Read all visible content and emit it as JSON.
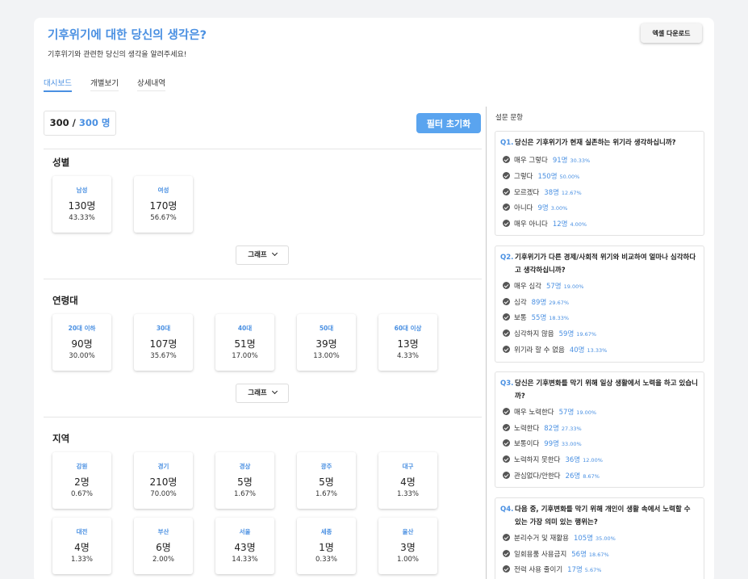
{
  "header": {
    "title": "기후위기에 대한 당신의 생각은?",
    "subtitle": "기후위기와 관련한 당신의 생각을 알려주세요!",
    "excel_label": "엑셀 다운로드"
  },
  "tabs": [
    {
      "label": "대시보드",
      "active": true
    },
    {
      "label": "개별보기",
      "active": false
    },
    {
      "label": "상세내역",
      "active": false
    }
  ],
  "counter": {
    "current": "300",
    "sep": " / ",
    "total": "300 명"
  },
  "reset_label": "필터 초기화",
  "graph_label": "그래프",
  "sections": [
    {
      "title": "성별",
      "cards": [
        {
          "label": "남성",
          "count": "130명",
          "pct": "43.33%"
        },
        {
          "label": "여성",
          "count": "170명",
          "pct": "56.67%"
        }
      ]
    },
    {
      "title": "연령대",
      "cards": [
        {
          "label": "20대 이하",
          "count": "90명",
          "pct": "30.00%"
        },
        {
          "label": "30대",
          "count": "107명",
          "pct": "35.67%"
        },
        {
          "label": "40대",
          "count": "51명",
          "pct": "17.00%"
        },
        {
          "label": "50대",
          "count": "39명",
          "pct": "13.00%"
        },
        {
          "label": "60대 이상",
          "count": "13명",
          "pct": "4.33%"
        }
      ]
    },
    {
      "title": "지역",
      "cards": [
        {
          "label": "강원",
          "count": "2명",
          "pct": "0.67%"
        },
        {
          "label": "경기",
          "count": "210명",
          "pct": "70.00%"
        },
        {
          "label": "경상",
          "count": "5명",
          "pct": "1.67%"
        },
        {
          "label": "광주",
          "count": "5명",
          "pct": "1.67%"
        },
        {
          "label": "대구",
          "count": "4명",
          "pct": "1.33%"
        },
        {
          "label": "대전",
          "count": "4명",
          "pct": "1.33%"
        },
        {
          "label": "부산",
          "count": "6명",
          "pct": "2.00%"
        },
        {
          "label": "서울",
          "count": "43명",
          "pct": "14.33%"
        },
        {
          "label": "세종",
          "count": "1명",
          "pct": "0.33%"
        },
        {
          "label": "울산",
          "count": "3명",
          "pct": "1.00%"
        }
      ]
    }
  ],
  "questions_heading": "설문 문항",
  "questions": [
    {
      "num": "Q1.",
      "text": "당신은 기후위기가 현재 실존하는 위기라 생각하십니까?",
      "options": [
        {
          "label": "매우 그렇다",
          "count": "91명",
          "pct": "30.33%"
        },
        {
          "label": "그렇다",
          "count": "150명",
          "pct": "50.00%"
        },
        {
          "label": "모르겠다",
          "count": "38명",
          "pct": "12.67%"
        },
        {
          "label": "아니다",
          "count": "9명",
          "pct": "3.00%"
        },
        {
          "label": "매우 아니다",
          "count": "12명",
          "pct": "4.00%"
        }
      ]
    },
    {
      "num": "Q2.",
      "text": "기후위기가 다른 경제/사회적 위기와 비교하여 얼마나 심각하다고 생각하십니까?",
      "options": [
        {
          "label": "매우 심각",
          "count": "57명",
          "pct": "19.00%"
        },
        {
          "label": "심각",
          "count": "89명",
          "pct": "29.67%"
        },
        {
          "label": "보통",
          "count": "55명",
          "pct": "18.33%"
        },
        {
          "label": "심각하지 않음",
          "count": "59명",
          "pct": "19.67%"
        },
        {
          "label": "위기라 할 수 없음",
          "count": "40명",
          "pct": "13.33%"
        }
      ]
    },
    {
      "num": "Q3.",
      "text": "당신은 기후변화를 막기 위해 일상 생활에서 노력을 하고 있습니까?",
      "options": [
        {
          "label": "매우 노력한다",
          "count": "57명",
          "pct": "19.00%"
        },
        {
          "label": "노력한다",
          "count": "82명",
          "pct": "27.33%"
        },
        {
          "label": "보통이다",
          "count": "99명",
          "pct": "33.00%"
        },
        {
          "label": "노력하지 못한다",
          "count": "36명",
          "pct": "12.00%"
        },
        {
          "label": "관심없다/안한다",
          "count": "26명",
          "pct": "8.67%"
        }
      ]
    },
    {
      "num": "Q4.",
      "text": "다음 중, 기후변화를 막기 위해 개인이 생활 속에서 노력할 수 있는 가장 의미 있는 행위는?",
      "options": [
        {
          "label": "분리수거 및 재활용",
          "count": "105명",
          "pct": "35.00%"
        },
        {
          "label": "일회용품 사용금지",
          "count": "56명",
          "pct": "18.67%"
        },
        {
          "label": "전력 사용 줄이기",
          "count": "17명",
          "pct": "5.67%"
        }
      ]
    }
  ],
  "colors": {
    "accent": "#4a90e2",
    "button": "#5aa4ef"
  }
}
